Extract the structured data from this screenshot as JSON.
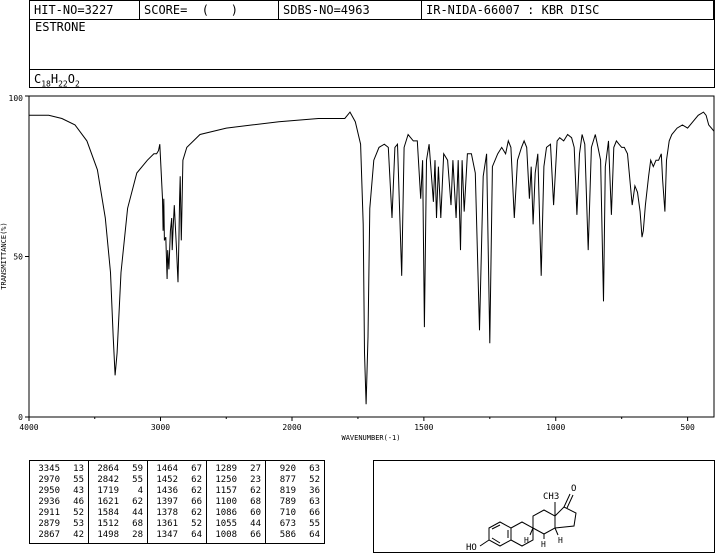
{
  "header": {
    "hit": "HIT-NO=3227",
    "score": "SCORE=  (   )",
    "sdbs": "SDBS-NO=4963",
    "source": "IR-NIDA-66007 : KBR DISC"
  },
  "compound": {
    "name": "ESTRONE",
    "formula": {
      "c": "C",
      "cn": "18",
      "h": "H",
      "hn": "22",
      "o": "O",
      "on": "2"
    }
  },
  "chart_data": {
    "type": "line",
    "title": "",
    "xlabel": "WAVENUMBER(-1)",
    "ylabel": "TRANSMITTANCE(%)",
    "xlim": [
      4000,
      400
    ],
    "ylim": [
      0,
      100
    ],
    "x_ticks": [
      4000,
      3000,
      2000,
      1500,
      1000,
      500
    ],
    "y_ticks": [
      0,
      50,
      100
    ],
    "grid": false,
    "series": [
      {
        "values": [
          [
            4000,
            94
          ],
          [
            3850,
            94
          ],
          [
            3750,
            93
          ],
          [
            3650,
            91
          ],
          [
            3560,
            86
          ],
          [
            3480,
            77
          ],
          [
            3420,
            62
          ],
          [
            3380,
            45
          ],
          [
            3360,
            25
          ],
          [
            3345,
            13
          ],
          [
            3330,
            20
          ],
          [
            3300,
            45
          ],
          [
            3250,
            65
          ],
          [
            3180,
            76
          ],
          [
            3100,
            80
          ],
          [
            3050,
            82
          ],
          [
            3030,
            82
          ],
          [
            3015,
            83
          ],
          [
            3005,
            85
          ],
          [
            2985,
            68
          ],
          [
            2980,
            58
          ],
          [
            2975,
            68
          ],
          [
            2970,
            55
          ],
          [
            2960,
            56
          ],
          [
            2950,
            43
          ],
          [
            2945,
            52
          ],
          [
            2936,
            46
          ],
          [
            2925,
            58
          ],
          [
            2915,
            62
          ],
          [
            2911,
            52
          ],
          [
            2905,
            58
          ],
          [
            2895,
            66
          ],
          [
            2879,
            53
          ],
          [
            2867,
            42
          ],
          [
            2860,
            55
          ],
          [
            2855,
            68
          ],
          [
            2850,
            75
          ],
          [
            2842,
            55
          ],
          [
            2830,
            80
          ],
          [
            2800,
            84
          ],
          [
            2700,
            88
          ],
          [
            2500,
            90
          ],
          [
            2300,
            91
          ],
          [
            2100,
            92
          ],
          [
            1900,
            93
          ],
          [
            1800,
            93
          ],
          [
            1780,
            95
          ],
          [
            1760,
            92
          ],
          [
            1740,
            85
          ],
          [
            1730,
            60
          ],
          [
            1725,
            20
          ],
          [
            1719,
            4
          ],
          [
            1712,
            25
          ],
          [
            1705,
            65
          ],
          [
            1690,
            80
          ],
          [
            1670,
            84
          ],
          [
            1650,
            85
          ],
          [
            1635,
            84
          ],
          [
            1621,
            62
          ],
          [
            1610,
            84
          ],
          [
            1600,
            85
          ],
          [
            1584,
            44
          ],
          [
            1575,
            84
          ],
          [
            1560,
            88
          ],
          [
            1540,
            86
          ],
          [
            1525,
            86
          ],
          [
            1512,
            68
          ],
          [
            1505,
            80
          ],
          [
            1498,
            28
          ],
          [
            1490,
            80
          ],
          [
            1480,
            85
          ],
          [
            1464,
            67
          ],
          [
            1458,
            80
          ],
          [
            1452,
            62
          ],
          [
            1445,
            78
          ],
          [
            1436,
            62
          ],
          [
            1425,
            82
          ],
          [
            1410,
            80
          ],
          [
            1397,
            66
          ],
          [
            1390,
            80
          ],
          [
            1378,
            62
          ],
          [
            1370,
            80
          ],
          [
            1361,
            52
          ],
          [
            1355,
            80
          ],
          [
            1347,
            64
          ],
          [
            1335,
            82
          ],
          [
            1320,
            82
          ],
          [
            1305,
            76
          ],
          [
            1289,
            27
          ],
          [
            1275,
            75
          ],
          [
            1262,
            82
          ],
          [
            1250,
            23
          ],
          [
            1240,
            78
          ],
          [
            1220,
            82
          ],
          [
            1205,
            84
          ],
          [
            1190,
            82
          ],
          [
            1180,
            86
          ],
          [
            1170,
            84
          ],
          [
            1157,
            62
          ],
          [
            1145,
            80
          ],
          [
            1130,
            84
          ],
          [
            1120,
            86
          ],
          [
            1110,
            84
          ],
          [
            1100,
            68
          ],
          [
            1093,
            78
          ],
          [
            1086,
            60
          ],
          [
            1078,
            76
          ],
          [
            1068,
            82
          ],
          [
            1055,
            44
          ],
          [
            1045,
            78
          ],
          [
            1035,
            84
          ],
          [
            1020,
            85
          ],
          [
            1008,
            66
          ],
          [
            995,
            86
          ],
          [
            985,
            87
          ],
          [
            970,
            86
          ],
          [
            955,
            88
          ],
          [
            940,
            87
          ],
          [
            930,
            84
          ],
          [
            920,
            63
          ],
          [
            910,
            82
          ],
          [
            900,
            88
          ],
          [
            890,
            85
          ],
          [
            877,
            52
          ],
          [
            865,
            84
          ],
          [
            850,
            88
          ],
          [
            840,
            84
          ],
          [
            830,
            80
          ],
          [
            819,
            36
          ],
          [
            812,
            78
          ],
          [
            800,
            86
          ],
          [
            789,
            63
          ],
          [
            780,
            84
          ],
          [
            770,
            86
          ],
          [
            760,
            85
          ],
          [
            750,
            84
          ],
          [
            740,
            84
          ],
          [
            728,
            82
          ],
          [
            710,
            66
          ],
          [
            700,
            72
          ],
          [
            690,
            70
          ],
          [
            680,
            64
          ],
          [
            673,
            56
          ],
          [
            668,
            58
          ],
          [
            660,
            66
          ],
          [
            648,
            75
          ],
          [
            640,
            80
          ],
          [
            630,
            78
          ],
          [
            620,
            80
          ],
          [
            610,
            80
          ],
          [
            600,
            82
          ],
          [
            595,
            74
          ],
          [
            586,
            64
          ],
          [
            580,
            80
          ],
          [
            570,
            86
          ],
          [
            560,
            88
          ],
          [
            540,
            90
          ],
          [
            520,
            91
          ],
          [
            500,
            90
          ],
          [
            480,
            92
          ],
          [
            460,
            94
          ],
          [
            440,
            95
          ],
          [
            430,
            94
          ],
          [
            420,
            91
          ],
          [
            410,
            90
          ],
          [
            400,
            89
          ]
        ]
      }
    ]
  },
  "peaks": [
    [
      [
        "3345",
        "13"
      ],
      [
        "2970",
        "55"
      ],
      [
        "2950",
        "43"
      ],
      [
        "2936",
        "46"
      ],
      [
        "2911",
        "52"
      ],
      [
        "2879",
        "53"
      ],
      [
        "2867",
        "42"
      ]
    ],
    [
      [
        "2864",
        "59"
      ],
      [
        "2842",
        "55"
      ],
      [
        "1719",
        "4"
      ],
      [
        "1621",
        "62"
      ],
      [
        "1584",
        "44"
      ],
      [
        "1512",
        "68"
      ],
      [
        "1498",
        "28"
      ]
    ],
    [
      [
        "1464",
        "67"
      ],
      [
        "1452",
        "62"
      ],
      [
        "1436",
        "62"
      ],
      [
        "1397",
        "66"
      ],
      [
        "1378",
        "62"
      ],
      [
        "1361",
        "52"
      ],
      [
        "1347",
        "64"
      ]
    ],
    [
      [
        "1289",
        "27"
      ],
      [
        "1250",
        "23"
      ],
      [
        "1157",
        "62"
      ],
      [
        "1100",
        "68"
      ],
      [
        "1086",
        "60"
      ],
      [
        "1055",
        "44"
      ],
      [
        "1008",
        "66"
      ]
    ],
    [
      [
        "920",
        "63"
      ],
      [
        "877",
        "52"
      ],
      [
        "819",
        "36"
      ],
      [
        "789",
        "63"
      ],
      [
        "710",
        "66"
      ],
      [
        "673",
        "55"
      ],
      [
        "586",
        "64"
      ]
    ]
  ],
  "structure": {
    "methyl_label": "CH3",
    "ketone_label": "O",
    "hydroxyl_label": "HO",
    "stereo_h1": "H",
    "stereo_h2": "H",
    "stereo_h3": "H"
  }
}
